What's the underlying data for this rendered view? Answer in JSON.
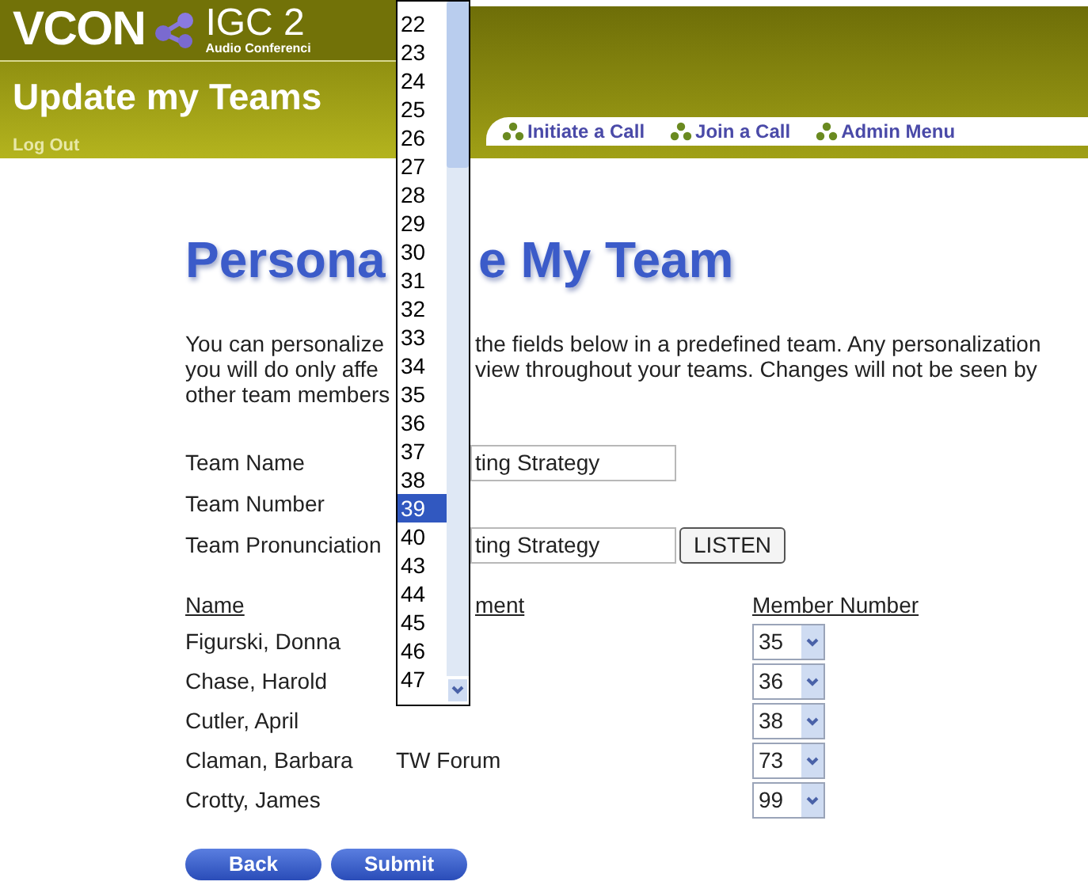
{
  "header": {
    "logo": "VCON",
    "product": "IGC 2",
    "product_subtitle": "Audio Conferenci",
    "page_title": "Update my Teams",
    "logout": "Log Out",
    "nav": [
      "Initiate a Call",
      "Join a Call",
      "Admin Menu"
    ]
  },
  "heading_parts": [
    "Persona",
    "e My Team"
  ],
  "intro_lines": [
    {
      "left": "You can personalize",
      "right": "the fields below in a predefined team. Any personalization"
    },
    {
      "left": "you will do only affe",
      "right": "view throughout your teams. Changes will not be seen by"
    },
    {
      "left": "other team members"
    }
  ],
  "fields": [
    {
      "label": "Team Name",
      "kind": "input",
      "value": "ting Strategy"
    },
    {
      "label": "Team Number",
      "kind": "none"
    },
    {
      "label": "Team Pronunciation",
      "kind": "input",
      "value": "ting Strategy",
      "button": "LISTEN"
    }
  ],
  "members": {
    "columns": [
      "Name",
      "ment",
      "Member Number"
    ],
    "rows": [
      {
        "name": "Figurski, Donna",
        "number": "35"
      },
      {
        "name": "Chase, Harold",
        "number": "36"
      },
      {
        "name": "Cutler, April",
        "number": "38"
      },
      {
        "name": "Claman, Barbara",
        "department": "TW Forum",
        "number": "73"
      },
      {
        "name": "Crotty, James",
        "number": "99"
      }
    ]
  },
  "dropdown": {
    "options": [
      {
        "label": "22",
        "selected": false
      },
      {
        "label": "23",
        "selected": false
      },
      {
        "label": "24",
        "selected": false
      },
      {
        "label": "25",
        "selected": false
      },
      {
        "label": "26",
        "selected": false
      },
      {
        "label": "27",
        "selected": false
      },
      {
        "label": "28",
        "selected": false
      },
      {
        "label": "29",
        "selected": false
      },
      {
        "label": "30",
        "selected": false
      },
      {
        "label": "31",
        "selected": false
      },
      {
        "label": "32",
        "selected": false
      },
      {
        "label": "33",
        "selected": false
      },
      {
        "label": "34",
        "selected": false
      },
      {
        "label": "35",
        "selected": false
      },
      {
        "label": "36",
        "selected": false
      },
      {
        "label": "37",
        "selected": false
      },
      {
        "label": "38",
        "selected": false
      },
      {
        "label": "39",
        "selected": true
      },
      {
        "label": "40",
        "selected": false
      },
      {
        "label": "43",
        "selected": false
      },
      {
        "label": "44",
        "selected": false
      },
      {
        "label": "45",
        "selected": false
      },
      {
        "label": "46",
        "selected": false
      },
      {
        "label": "47",
        "selected": false
      }
    ]
  },
  "buttons": [
    "Back",
    "Submit"
  ]
}
